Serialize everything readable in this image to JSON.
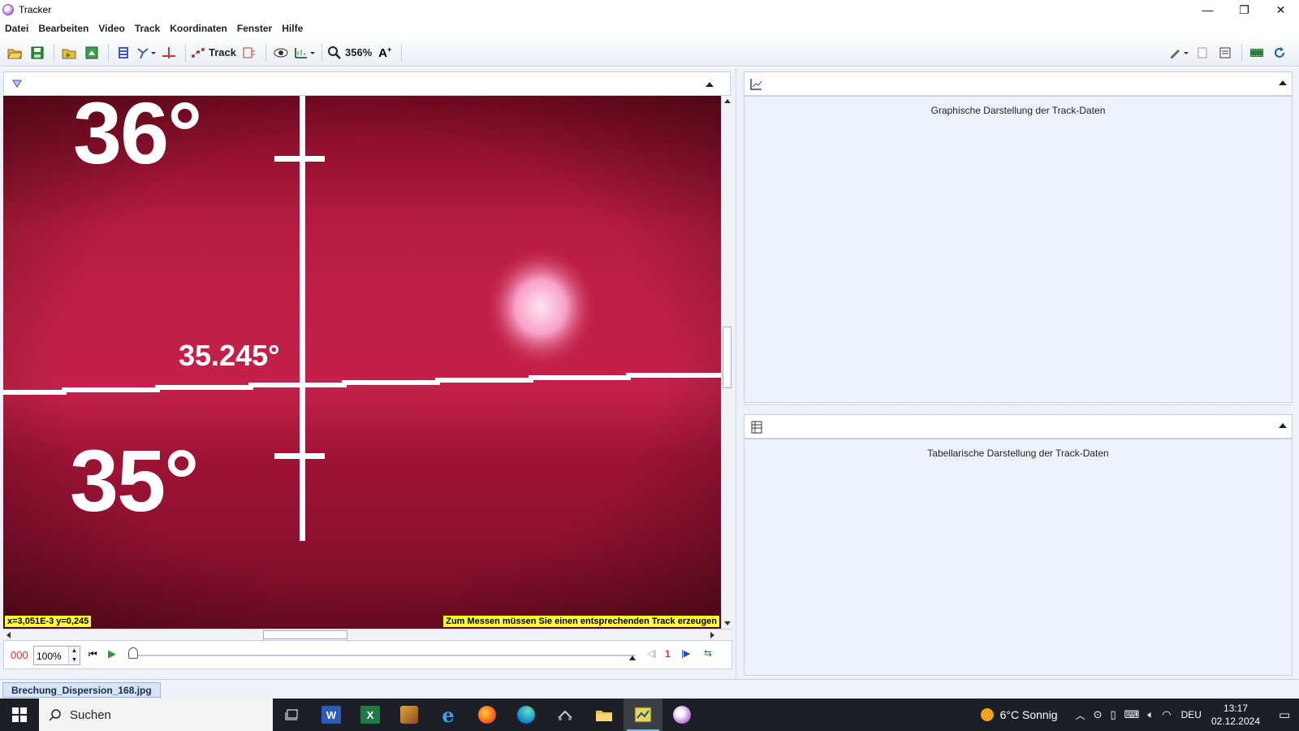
{
  "window": {
    "title": "Tracker",
    "minimize": "—",
    "restore": "❐",
    "close": "✕"
  },
  "menu": [
    "Datei",
    "Bearbeiten",
    "Video",
    "Track",
    "Koordinaten",
    "Fenster",
    "Hilfe"
  ],
  "toolbar": {
    "track_label": "Track",
    "zoom_label": "356%"
  },
  "video": {
    "label_top_angle": "36°",
    "label_mid_angle": "35.245°",
    "label_bottom_angle": "35°",
    "coord_readout": "x=3,051E-3  y=0,245",
    "measure_hint": "Zum Messen müssen Sie einen entsprechenden Track erzeugen"
  },
  "player": {
    "frame_number": "000",
    "rate_value": "100%",
    "step_value": "1"
  },
  "plot_panel": {
    "placeholder": "Graphische Darstellung der Track-Daten"
  },
  "table_panel": {
    "placeholder": "Tabellarische Darstellung der Track-Daten"
  },
  "file_tab": {
    "label": "Brechung_Dispersion_168.jpg"
  },
  "taskbar": {
    "search_label": "Suchen",
    "weather": "6°C  Sonnig",
    "language": "DEU",
    "time": "13:17",
    "date": "02.12.2024"
  },
  "colors": {
    "accent": "#1a5fb4",
    "hint_bg": "#ffff33",
    "video_bg": "#8a1230"
  }
}
